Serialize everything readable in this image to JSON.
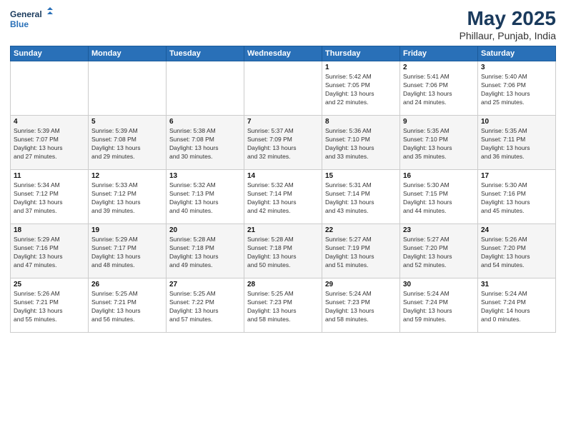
{
  "logo": {
    "line1": "General",
    "line2": "Blue"
  },
  "title": "May 2025",
  "subtitle": "Phillaur, Punjab, India",
  "days_of_week": [
    "Sunday",
    "Monday",
    "Tuesday",
    "Wednesday",
    "Thursday",
    "Friday",
    "Saturday"
  ],
  "weeks": [
    [
      {
        "day": "",
        "content": ""
      },
      {
        "day": "",
        "content": ""
      },
      {
        "day": "",
        "content": ""
      },
      {
        "day": "",
        "content": ""
      },
      {
        "day": "1",
        "content": "Sunrise: 5:42 AM\nSunset: 7:05 PM\nDaylight: 13 hours\nand 22 minutes."
      },
      {
        "day": "2",
        "content": "Sunrise: 5:41 AM\nSunset: 7:06 PM\nDaylight: 13 hours\nand 24 minutes."
      },
      {
        "day": "3",
        "content": "Sunrise: 5:40 AM\nSunset: 7:06 PM\nDaylight: 13 hours\nand 25 minutes."
      }
    ],
    [
      {
        "day": "4",
        "content": "Sunrise: 5:39 AM\nSunset: 7:07 PM\nDaylight: 13 hours\nand 27 minutes."
      },
      {
        "day": "5",
        "content": "Sunrise: 5:39 AM\nSunset: 7:08 PM\nDaylight: 13 hours\nand 29 minutes."
      },
      {
        "day": "6",
        "content": "Sunrise: 5:38 AM\nSunset: 7:08 PM\nDaylight: 13 hours\nand 30 minutes."
      },
      {
        "day": "7",
        "content": "Sunrise: 5:37 AM\nSunset: 7:09 PM\nDaylight: 13 hours\nand 32 minutes."
      },
      {
        "day": "8",
        "content": "Sunrise: 5:36 AM\nSunset: 7:10 PM\nDaylight: 13 hours\nand 33 minutes."
      },
      {
        "day": "9",
        "content": "Sunrise: 5:35 AM\nSunset: 7:10 PM\nDaylight: 13 hours\nand 35 minutes."
      },
      {
        "day": "10",
        "content": "Sunrise: 5:35 AM\nSunset: 7:11 PM\nDaylight: 13 hours\nand 36 minutes."
      }
    ],
    [
      {
        "day": "11",
        "content": "Sunrise: 5:34 AM\nSunset: 7:12 PM\nDaylight: 13 hours\nand 37 minutes."
      },
      {
        "day": "12",
        "content": "Sunrise: 5:33 AM\nSunset: 7:12 PM\nDaylight: 13 hours\nand 39 minutes."
      },
      {
        "day": "13",
        "content": "Sunrise: 5:32 AM\nSunset: 7:13 PM\nDaylight: 13 hours\nand 40 minutes."
      },
      {
        "day": "14",
        "content": "Sunrise: 5:32 AM\nSunset: 7:14 PM\nDaylight: 13 hours\nand 42 minutes."
      },
      {
        "day": "15",
        "content": "Sunrise: 5:31 AM\nSunset: 7:14 PM\nDaylight: 13 hours\nand 43 minutes."
      },
      {
        "day": "16",
        "content": "Sunrise: 5:30 AM\nSunset: 7:15 PM\nDaylight: 13 hours\nand 44 minutes."
      },
      {
        "day": "17",
        "content": "Sunrise: 5:30 AM\nSunset: 7:16 PM\nDaylight: 13 hours\nand 45 minutes."
      }
    ],
    [
      {
        "day": "18",
        "content": "Sunrise: 5:29 AM\nSunset: 7:16 PM\nDaylight: 13 hours\nand 47 minutes."
      },
      {
        "day": "19",
        "content": "Sunrise: 5:29 AM\nSunset: 7:17 PM\nDaylight: 13 hours\nand 48 minutes."
      },
      {
        "day": "20",
        "content": "Sunrise: 5:28 AM\nSunset: 7:18 PM\nDaylight: 13 hours\nand 49 minutes."
      },
      {
        "day": "21",
        "content": "Sunrise: 5:28 AM\nSunset: 7:18 PM\nDaylight: 13 hours\nand 50 minutes."
      },
      {
        "day": "22",
        "content": "Sunrise: 5:27 AM\nSunset: 7:19 PM\nDaylight: 13 hours\nand 51 minutes."
      },
      {
        "day": "23",
        "content": "Sunrise: 5:27 AM\nSunset: 7:20 PM\nDaylight: 13 hours\nand 52 minutes."
      },
      {
        "day": "24",
        "content": "Sunrise: 5:26 AM\nSunset: 7:20 PM\nDaylight: 13 hours\nand 54 minutes."
      }
    ],
    [
      {
        "day": "25",
        "content": "Sunrise: 5:26 AM\nSunset: 7:21 PM\nDaylight: 13 hours\nand 55 minutes."
      },
      {
        "day": "26",
        "content": "Sunrise: 5:25 AM\nSunset: 7:21 PM\nDaylight: 13 hours\nand 56 minutes."
      },
      {
        "day": "27",
        "content": "Sunrise: 5:25 AM\nSunset: 7:22 PM\nDaylight: 13 hours\nand 57 minutes."
      },
      {
        "day": "28",
        "content": "Sunrise: 5:25 AM\nSunset: 7:23 PM\nDaylight: 13 hours\nand 58 minutes."
      },
      {
        "day": "29",
        "content": "Sunrise: 5:24 AM\nSunset: 7:23 PM\nDaylight: 13 hours\nand 58 minutes."
      },
      {
        "day": "30",
        "content": "Sunrise: 5:24 AM\nSunset: 7:24 PM\nDaylight: 13 hours\nand 59 minutes."
      },
      {
        "day": "31",
        "content": "Sunrise: 5:24 AM\nSunset: 7:24 PM\nDaylight: 14 hours\nand 0 minutes."
      }
    ]
  ]
}
